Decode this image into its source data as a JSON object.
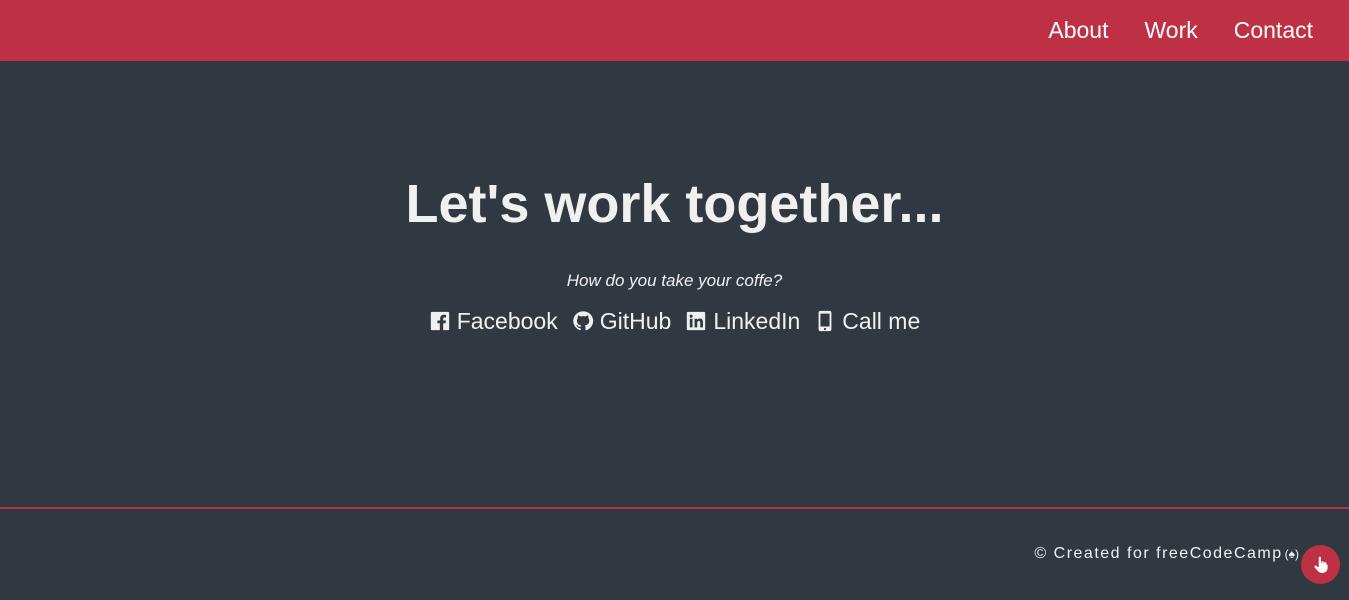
{
  "nav": {
    "items": [
      {
        "label": "About"
      },
      {
        "label": "Work"
      },
      {
        "label": "Contact"
      }
    ]
  },
  "contact": {
    "headline": "Let's work together...",
    "subline": "How do you take your coffe?",
    "links": [
      {
        "label": "Facebook",
        "icon": "facebook-square-icon"
      },
      {
        "label": "GitHub",
        "icon": "github-icon"
      },
      {
        "label": "LinkedIn",
        "icon": "linkedin-icon"
      },
      {
        "label": "Call me",
        "icon": "mobile-phone-icon"
      }
    ]
  },
  "footer": {
    "prefix": "© Created for ",
    "link": "freeCodeCamp",
    "logo_glyph": "(♠)"
  },
  "floating_button": {
    "icon": "hand-pointer-icon"
  },
  "colors": {
    "accent": "#be3144",
    "background": "#303841",
    "text": "#f0f0f0"
  }
}
